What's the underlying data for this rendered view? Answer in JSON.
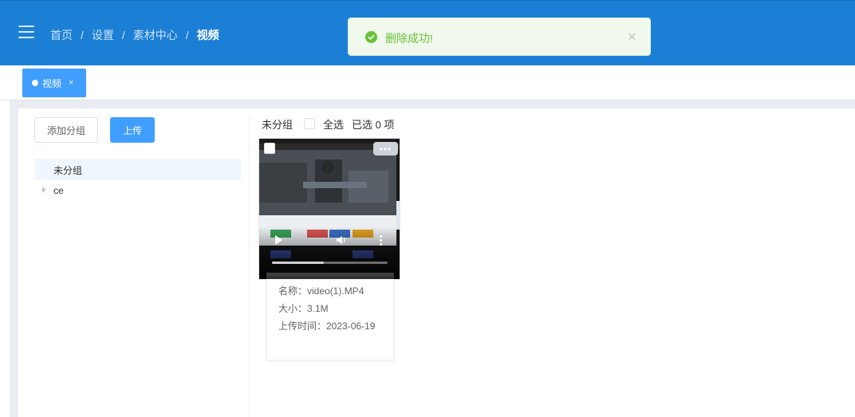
{
  "breadcrumb": {
    "items": [
      "首页",
      "设置",
      "素材中心"
    ],
    "current": "视频",
    "separator": "/"
  },
  "toast": {
    "message": "删除成功!",
    "close": "×",
    "color": "#67c23a"
  },
  "tabs": [
    {
      "label": "视频",
      "close": "×",
      "active": true
    }
  ],
  "sidebar": {
    "add_group_label": "添加分组",
    "upload_label": "上传",
    "groups": [
      {
        "label": "未分组",
        "active": true
      },
      {
        "label": "ce",
        "expandable": true
      }
    ]
  },
  "gallery": {
    "group_title": "未分组",
    "select_all_label": "全选",
    "selected_text": "已选 0 项",
    "items": [
      {
        "more_label": "•••",
        "progress": 0.45,
        "name_label": "名称：video(1).MP4",
        "size_label": "大小：3.1M",
        "time_label": "上传时间：2023-06-19"
      }
    ]
  },
  "colors": {
    "header": "#1b7fd6",
    "accent": "#409eff",
    "success": "#67c23a"
  }
}
